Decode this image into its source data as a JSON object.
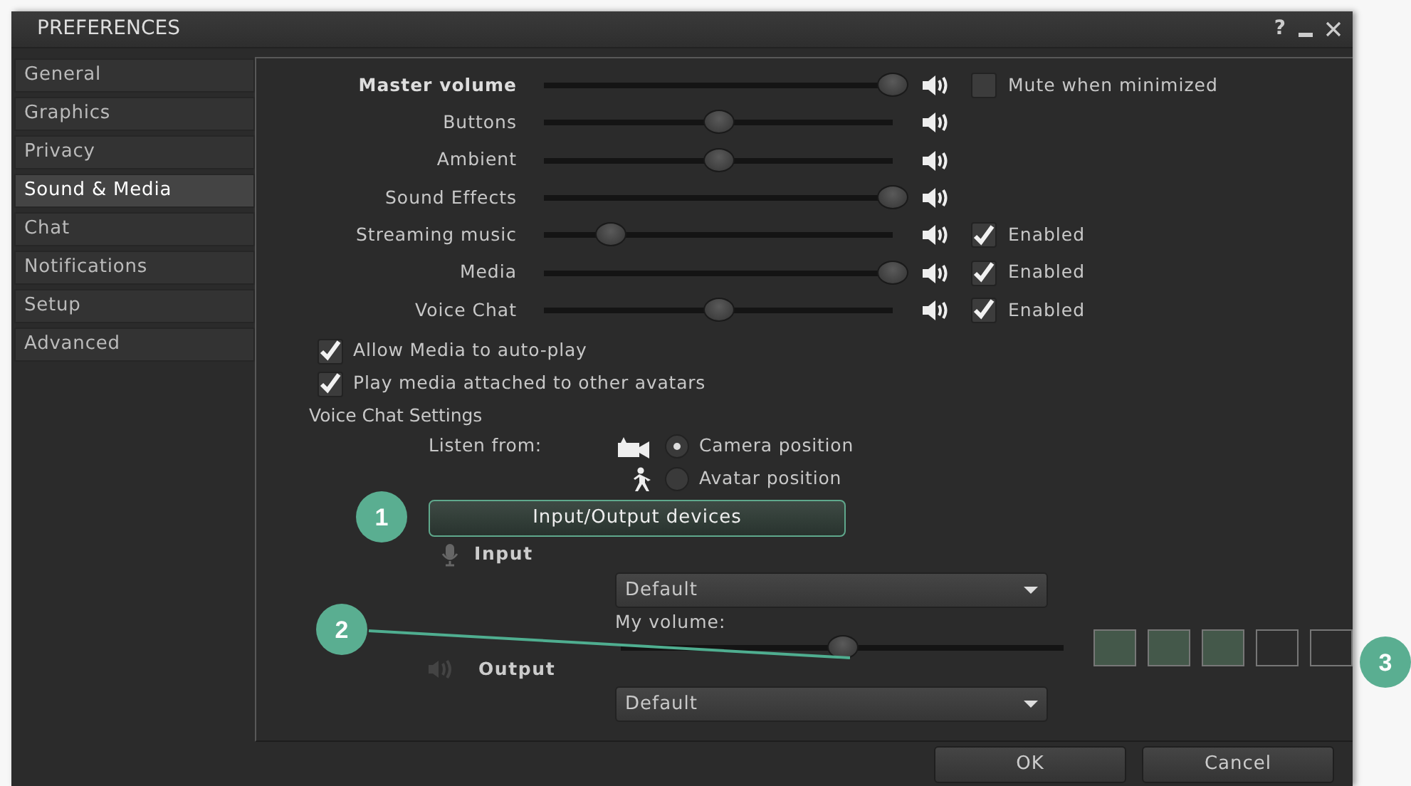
{
  "window": {
    "title": "PREFERENCES",
    "help": "?"
  },
  "tabs": [
    {
      "label": "General",
      "selected": false
    },
    {
      "label": "Graphics",
      "selected": false
    },
    {
      "label": "Privacy",
      "selected": false
    },
    {
      "label": "Sound & Media",
      "selected": true
    },
    {
      "label": "Chat",
      "selected": false
    },
    {
      "label": "Notifications",
      "selected": false
    },
    {
      "label": "Setup",
      "selected": false
    },
    {
      "label": "Advanced",
      "selected": false
    }
  ],
  "volume_rows": [
    {
      "kind": "master",
      "label": "Master volume",
      "level": 1.0,
      "checkbox": {
        "label": "Mute when minimized",
        "checked": false
      }
    },
    {
      "kind": "channel",
      "label": "Buttons",
      "level": 0.5
    },
    {
      "kind": "channel",
      "label": "Ambient",
      "level": 0.5
    },
    {
      "kind": "channel",
      "label": "Sound Effects",
      "level": 1.0
    },
    {
      "kind": "channel",
      "label": "Streaming music",
      "level": 0.19,
      "checkbox": {
        "label": "Enabled",
        "checked": true
      }
    },
    {
      "kind": "channel",
      "label": "Media",
      "level": 1.0,
      "checkbox": {
        "label": "Enabled",
        "checked": true
      }
    },
    {
      "kind": "channel",
      "label": "Voice Chat",
      "level": 0.5,
      "checkbox": {
        "label": "Enabled",
        "checked": true
      }
    }
  ],
  "options": [
    {
      "label": "Allow Media to auto-play",
      "checked": true
    },
    {
      "label": "Play media attached to other avatars",
      "checked": true
    }
  ],
  "voice_chat": {
    "heading": "Voice Chat Settings",
    "listen_from_label": "Listen from:",
    "listen_options": [
      {
        "kind": "camera",
        "label": "Camera position",
        "selected": true
      },
      {
        "kind": "avatar",
        "label": "Avatar position",
        "selected": false
      }
    ],
    "devices_button": "Input/Output devices",
    "input": {
      "label": "Input",
      "device": "Default"
    },
    "my_volume": {
      "label": "My volume:",
      "level": 0.5
    },
    "input_meter": [
      {
        "lit": true
      },
      {
        "lit": true
      },
      {
        "lit": true
      },
      {
        "lit": false
      },
      {
        "lit": false
      }
    ],
    "output": {
      "label": "Output",
      "device": "Default"
    }
  },
  "buttons": [
    "OK",
    "Cancel"
  ],
  "callouts": [
    {
      "number": "1"
    },
    {
      "number": "2"
    },
    {
      "number": "3"
    }
  ]
}
